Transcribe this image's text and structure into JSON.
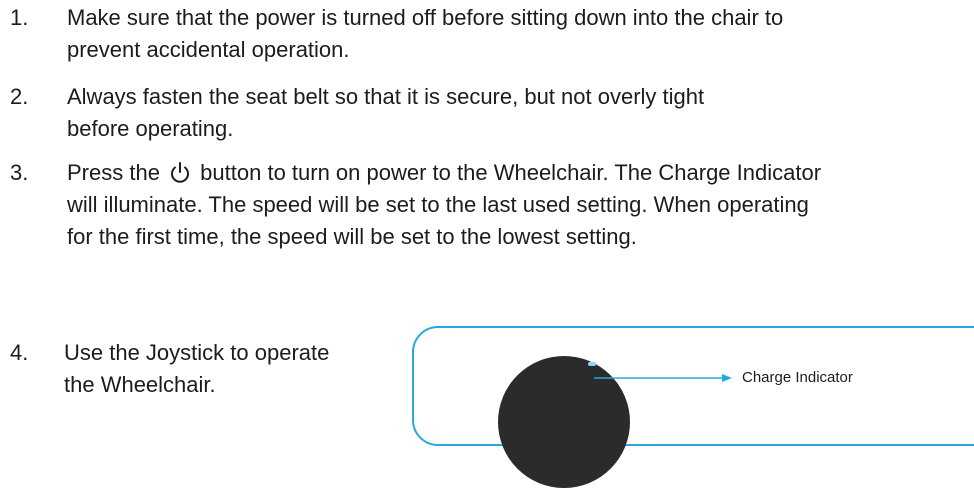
{
  "steps": [
    {
      "number": "1.",
      "lines": [
        "Make sure that the power is turned off before sitting down into the chair to",
        "prevent accidental operation."
      ]
    },
    {
      "number": "2.",
      "lines": [
        "Always fasten the seat belt so that it is secure, but not overly tight",
        "before operating."
      ]
    },
    {
      "number": "3.",
      "line1_before": "Press the",
      "line1_after": " button to turn on power to the Wheelchair. The Charge Indicator",
      "lines": [
        "will illuminate. The speed will be set to the last used setting. When operating",
        "for the first time, the speed will be set to the lowest setting."
      ]
    },
    {
      "number": "4.",
      "lines": [
        "Use the Joystick to operate",
        "the Wheelchair."
      ]
    }
  ],
  "icons": {
    "power_button": "power-icon"
  },
  "diagram": {
    "callout_label": "Charge Indicator",
    "accent_color": "#2aa8dd"
  }
}
